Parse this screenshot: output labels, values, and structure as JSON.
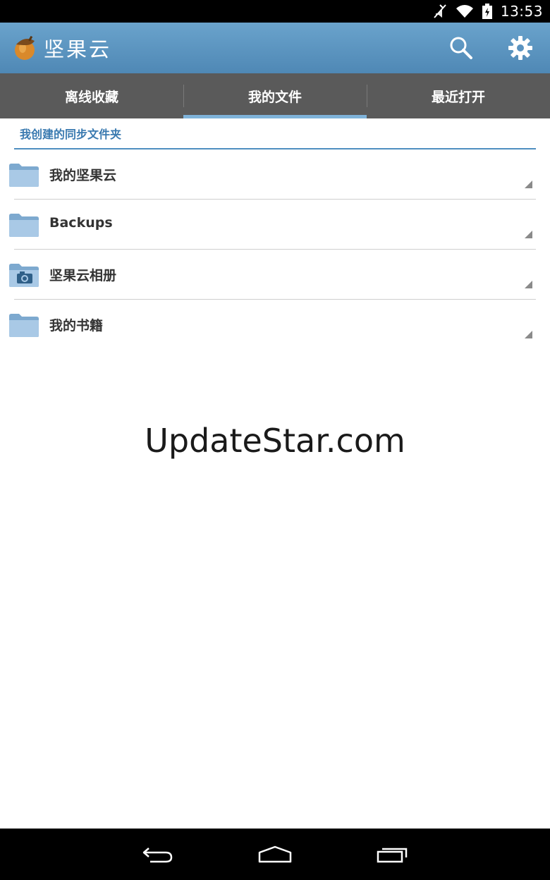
{
  "status_bar": {
    "time": "13:53",
    "icons": [
      "muted-icon",
      "wifi-icon",
      "battery-charging-icon"
    ]
  },
  "action_bar": {
    "title": "坚果云",
    "logo": "acorn-icon",
    "actions": [
      "search-icon",
      "gear-icon"
    ]
  },
  "tabs": [
    {
      "label": "离线收藏",
      "active": false
    },
    {
      "label": "我的文件",
      "active": true
    },
    {
      "label": "最近打开",
      "active": false
    }
  ],
  "section": {
    "title": "我创建的同步文件夹"
  },
  "folders": [
    {
      "name": "我的坚果云",
      "icon": "folder-icon"
    },
    {
      "name": "Backups",
      "icon": "folder-icon"
    },
    {
      "name": "坚果云相册",
      "icon": "camera-folder-icon"
    },
    {
      "name": "我的书籍",
      "icon": "folder-icon"
    }
  ],
  "watermark": "UpdateStar.com",
  "nav_bar": [
    "back-icon",
    "home-icon",
    "recents-icon"
  ],
  "colors": {
    "action_bar": "#5a93c0",
    "tab_bar": "#5a5a5a",
    "accent": "#4f8fc0"
  }
}
